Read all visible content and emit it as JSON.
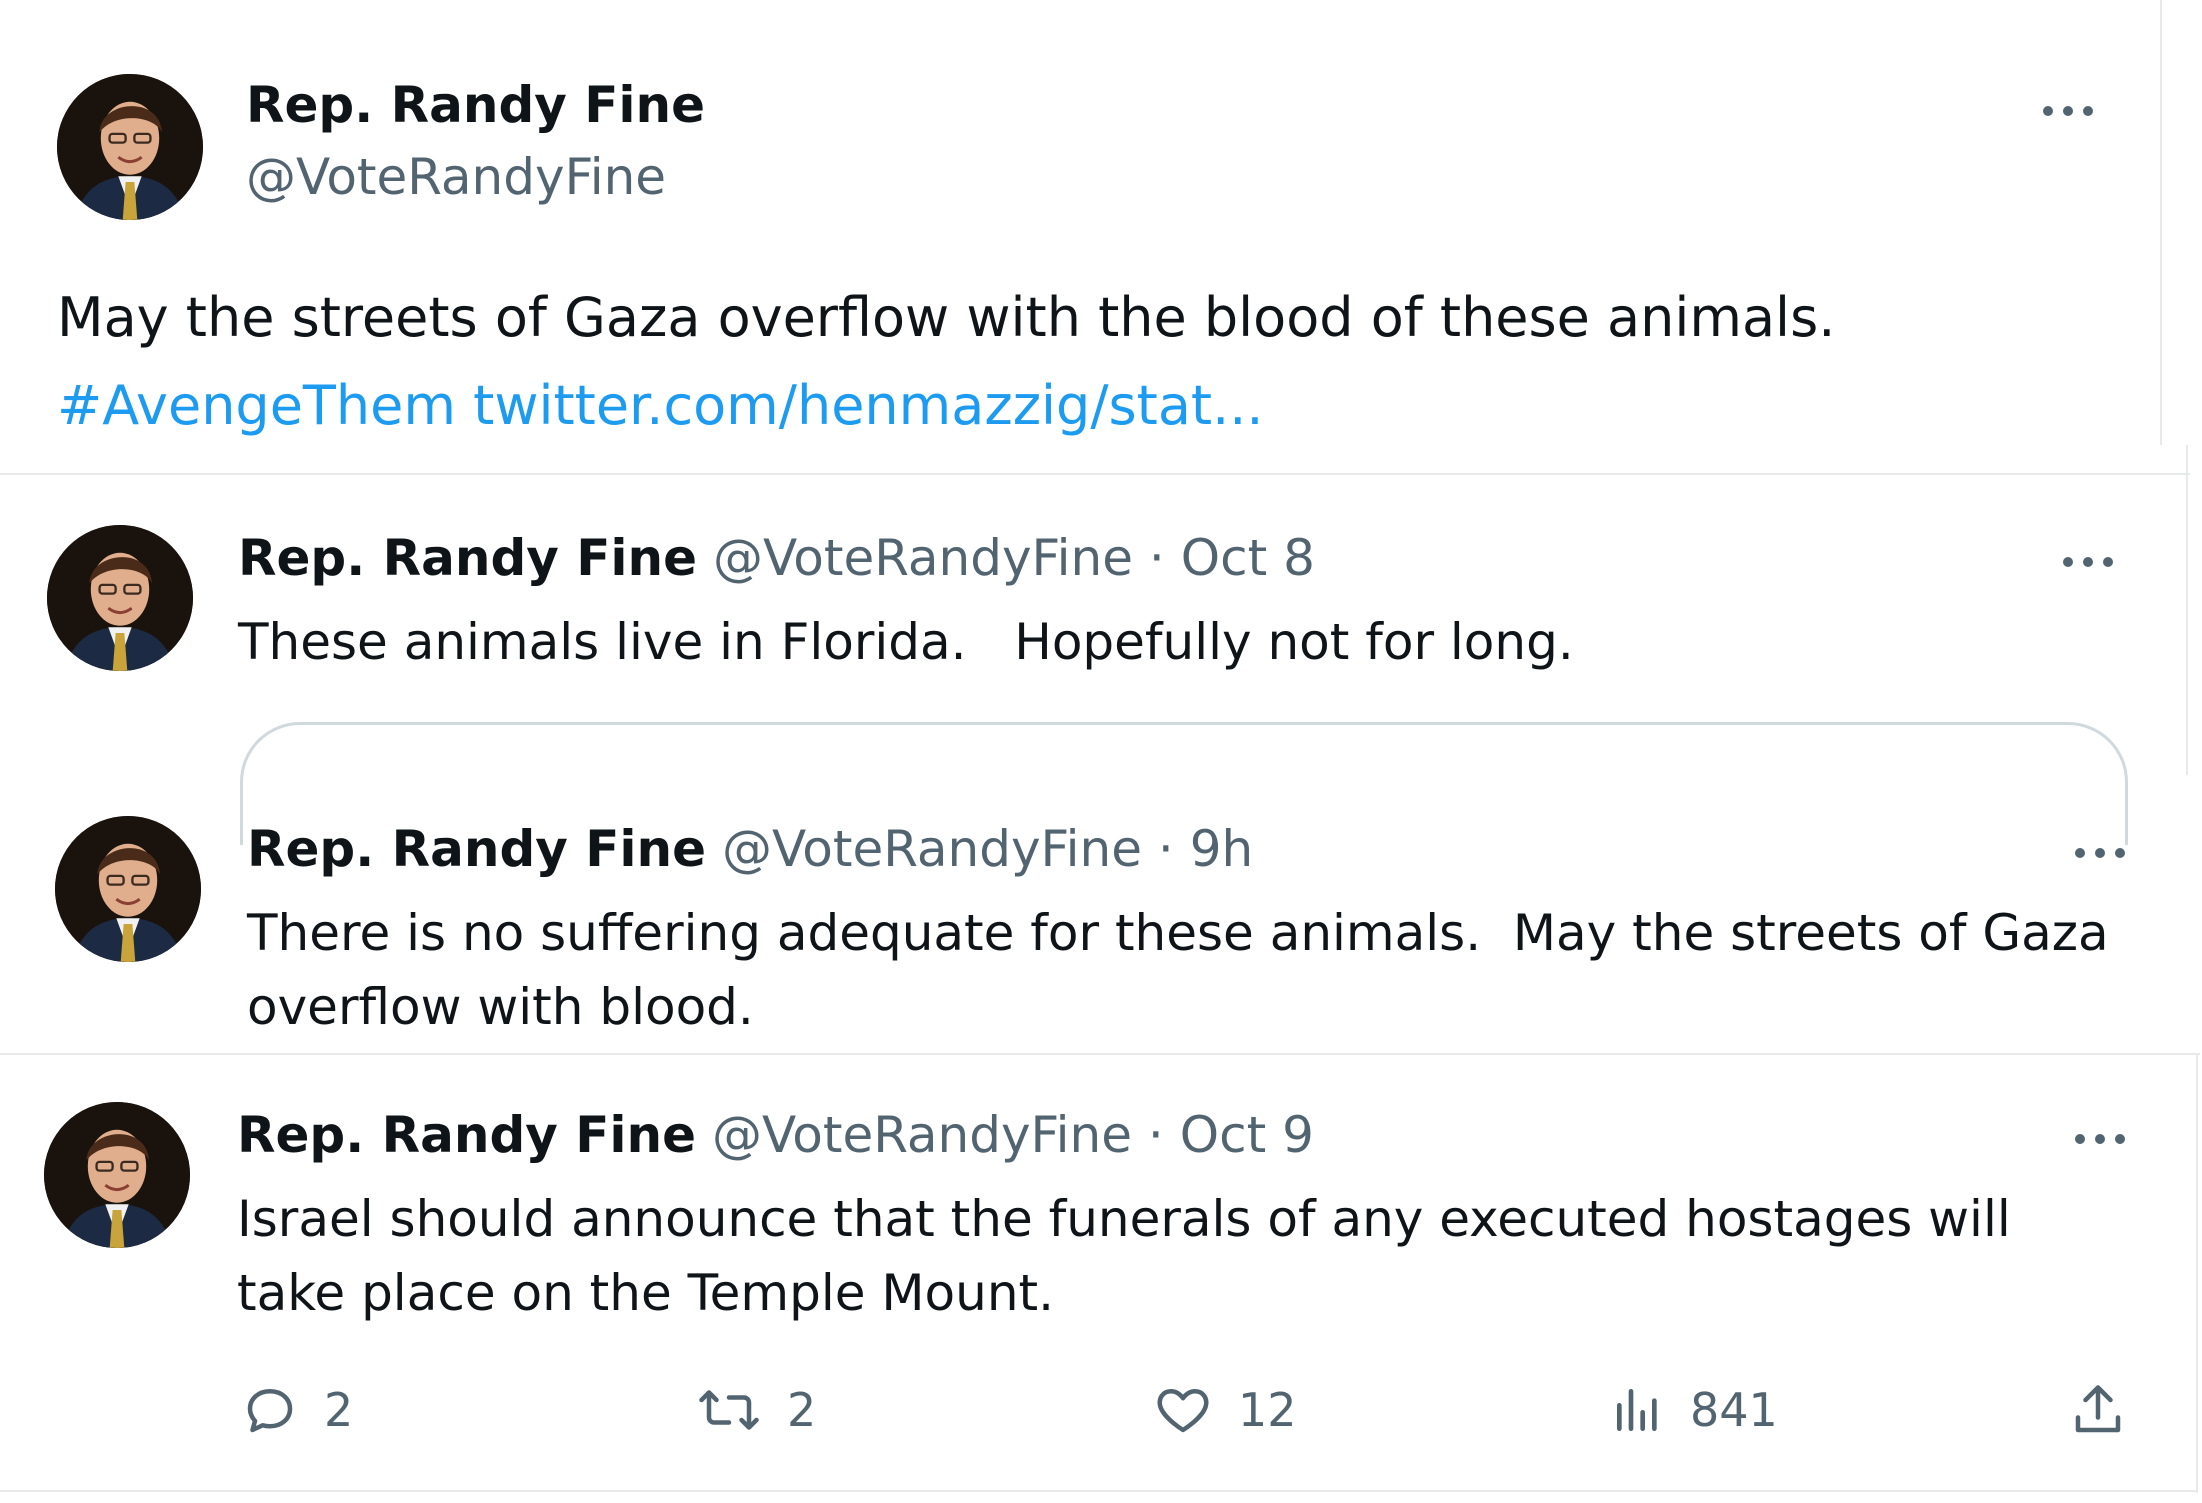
{
  "tweet_main": {
    "name": "Rep. Randy Fine",
    "handle": "@VoteRandyFine",
    "text": "May the streets of Gaza overflow with the blood of these animals.",
    "hashtag": "#AvengeThem",
    "link": "twitter.com/henmazzig/stat..."
  },
  "tweet_2": {
    "name": "Rep. Randy Fine",
    "handle": "@VoteRandyFine",
    "separator": "·",
    "time": "Oct 8",
    "text": "These animals live in Florida.   Hopefully not for long."
  },
  "tweet_3": {
    "name": "Rep. Randy Fine",
    "handle": "@VoteRandyFine",
    "separator": "·",
    "time": "9h",
    "text": "There is no suffering adequate for these animals.  May the streets of Gaza overflow with blood."
  },
  "tweet_4": {
    "name": "Rep. Randy Fine",
    "handle": "@VoteRandyFine",
    "separator": "·",
    "time": "Oct 9",
    "text": "Israel should announce that the funerals of any executed hostages will take place on the Temple Mount.",
    "actions": {
      "replies": "2",
      "retweets": "2",
      "likes": "12",
      "views": "841"
    }
  },
  "icons": {
    "reply": "reply-icon",
    "retweet": "retweet-icon",
    "like": "heart-icon",
    "views": "views-icon",
    "share": "share-icon",
    "more": "more-icon"
  },
  "colors": {
    "text": "#0f1419",
    "muted": "#536471",
    "link": "#1d9bf0",
    "border": "#e7e9ea"
  }
}
